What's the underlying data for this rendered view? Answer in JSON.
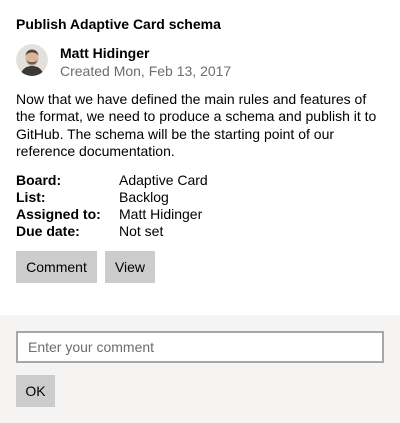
{
  "card": {
    "title": "Publish Adaptive Card schema",
    "author": {
      "name": "Matt Hidinger",
      "created": "Created Mon, Feb 13, 2017"
    },
    "description": "Now that we have defined the main rules and features of the format, we need to produce a schema and publish it to GitHub. The schema will be the starting point of our reference documentation.",
    "facts": [
      {
        "key": "Board:",
        "value": "Adaptive Card"
      },
      {
        "key": "List:",
        "value": "Backlog"
      },
      {
        "key": "Assigned to:",
        "value": "Matt Hidinger"
      },
      {
        "key": "Due date:",
        "value": "Not set"
      }
    ],
    "actions": {
      "comment_label": "Comment",
      "view_label": "View"
    }
  },
  "comment": {
    "placeholder": "Enter your comment",
    "value": "",
    "ok_label": "OK"
  },
  "colors": {
    "button_background": "#cccccc",
    "panel_background": "#f5f4f2",
    "input_border": "#a7a7a7",
    "secondary_text": "#6d6d6d"
  },
  "icons": {
    "avatar": "user-avatar-icon"
  }
}
